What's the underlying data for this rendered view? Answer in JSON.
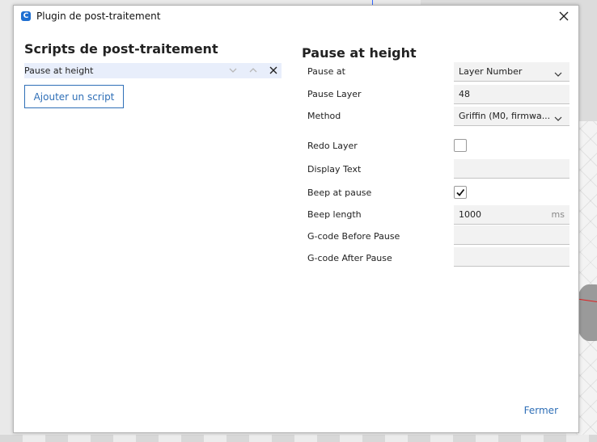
{
  "window": {
    "title": "Plugin de post-traitement",
    "app_icon_letter": "C"
  },
  "left": {
    "heading": "Scripts de post-traitement",
    "scripts": [
      {
        "label": "Pause at height"
      }
    ],
    "add_button": "Ajouter un script"
  },
  "right": {
    "heading": "Pause at height",
    "settings": {
      "pause_at": {
        "label": "Pause at",
        "value": "Layer Number"
      },
      "pause_layer": {
        "label": "Pause Layer",
        "value": "48"
      },
      "method": {
        "label": "Method",
        "value": "Griffin (M0, firmwa..."
      },
      "redo_layer": {
        "label": "Redo Layer",
        "checked": false
      },
      "display_text": {
        "label": "Display Text",
        "value": ""
      },
      "beep_at_pause": {
        "label": "Beep at pause",
        "checked": true
      },
      "beep_length": {
        "label": "Beep length",
        "value": "1000",
        "unit": "ms"
      },
      "gcode_before": {
        "label": "G-code Before Pause",
        "value": ""
      },
      "gcode_after": {
        "label": "G-code After Pause",
        "value": ""
      }
    }
  },
  "footer": {
    "close_label": "Fermer"
  },
  "colors": {
    "accent": "#2f6fb7",
    "selected_row": "#e8eefb",
    "field_bg": "#f2f2f2"
  }
}
